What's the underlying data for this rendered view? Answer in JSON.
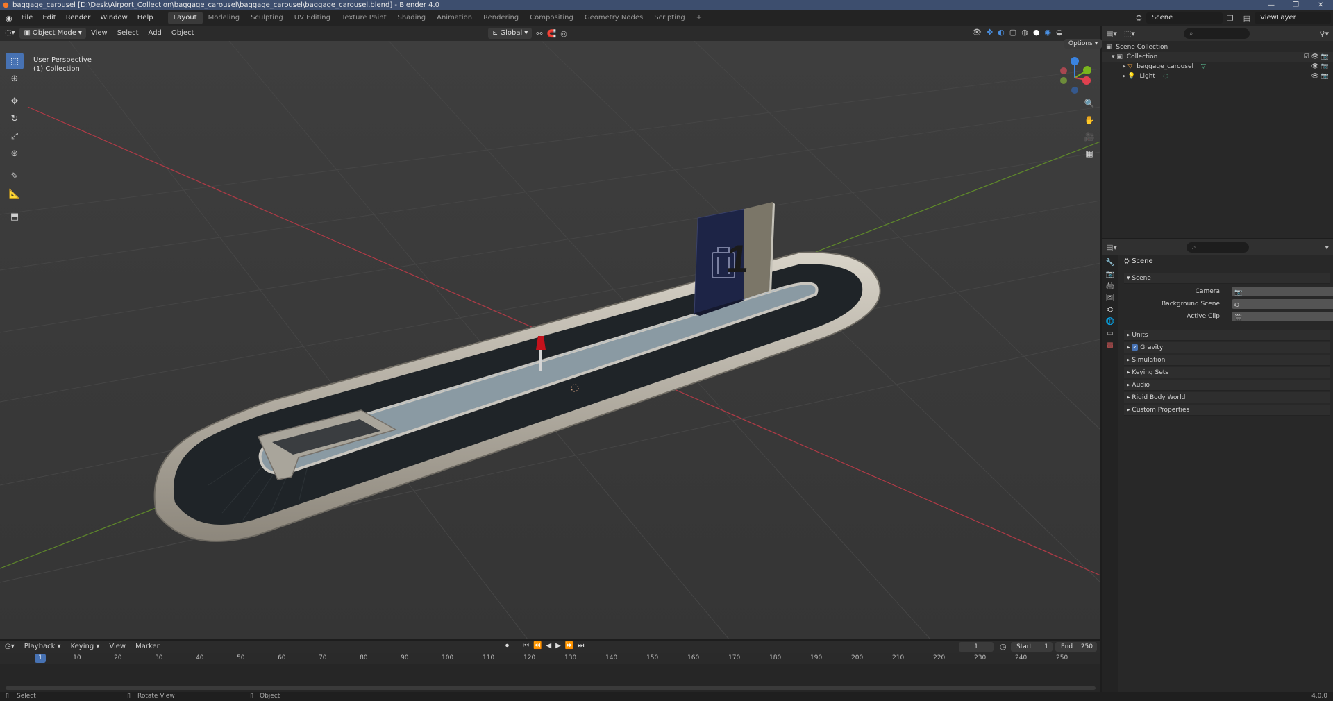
{
  "window": {
    "title": "baggage_carousel [D:\\Desk\\Airport_Collection\\baggage_carousel\\baggage_carousel\\baggage_carousel.blend] - Blender 4.0"
  },
  "menu": {
    "items": [
      "File",
      "Edit",
      "Render",
      "Window",
      "Help"
    ],
    "workspaces": [
      "Layout",
      "Modeling",
      "Sculpting",
      "UV Editing",
      "Texture Paint",
      "Shading",
      "Animation",
      "Rendering",
      "Compositing",
      "Geometry Nodes",
      "Scripting"
    ],
    "active_workspace": "Layout",
    "scene_label": "Scene",
    "viewlayer_label": "ViewLayer"
  },
  "viewport_header": {
    "mode": "Object Mode",
    "menus": [
      "View",
      "Select",
      "Add",
      "Object"
    ],
    "orientation": "Global",
    "options_label": "Options"
  },
  "viewport": {
    "perspective": "User Perspective",
    "collection": "(1) Collection",
    "sign_number": "1",
    "axis_colors": {
      "x": "#e0414f",
      "y": "#7ab51d",
      "z": "#3a83e0"
    }
  },
  "outliner": {
    "root": "Scene Collection",
    "collection": "Collection",
    "items": [
      {
        "name": "baggage_carousel",
        "icon": "mesh-icon"
      },
      {
        "name": "Light",
        "icon": "light-icon"
      }
    ]
  },
  "properties": {
    "context": "Scene",
    "panel": "Scene",
    "fields": [
      {
        "label": "Camera"
      },
      {
        "label": "Background Scene"
      },
      {
        "label": "Active Clip"
      }
    ],
    "sections": [
      "Units",
      "Gravity",
      "Simulation",
      "Keying Sets",
      "Audio",
      "Rigid Body World",
      "Custom Properties"
    ],
    "gravity_checked": true
  },
  "timeline": {
    "menus": [
      "Playback",
      "Keying",
      "View",
      "Marker"
    ],
    "current_frame": "1",
    "start_label": "Start",
    "start": "1",
    "end_label": "End",
    "end": "250",
    "ticks": [
      "10",
      "20",
      "30",
      "40",
      "50",
      "60",
      "70",
      "80",
      "90",
      "100",
      "110",
      "120",
      "130",
      "140",
      "150",
      "160",
      "170",
      "180",
      "190",
      "200",
      "210",
      "220",
      "230",
      "240",
      "250"
    ]
  },
  "statusbar": {
    "select": "Select",
    "rotate": "Rotate View",
    "object": "Object",
    "version": "4.0.0"
  }
}
